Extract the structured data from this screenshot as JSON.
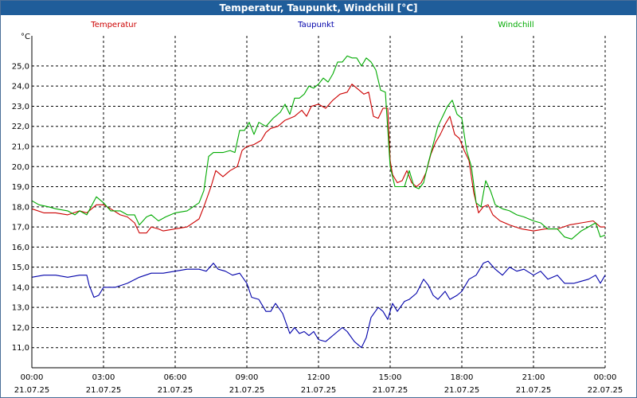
{
  "window": {
    "title": "Temperatur, Taupunkt, Windchill [°C]"
  },
  "chart_data": {
    "type": "line",
    "title": "Temperatur, Taupunkt, Windchill [°C]",
    "ylabel": "°C",
    "ylim": [
      10.0,
      26.5
    ],
    "grid": true,
    "legend_position": "top",
    "y_ticks": [
      "11,0",
      "12,0",
      "13,0",
      "14,0",
      "15,0",
      "16,0",
      "17,0",
      "18,0",
      "19,0",
      "20,0",
      "21,0",
      "22,0",
      "23,0",
      "24,0",
      "25,0"
    ],
    "x_ticks": [
      {
        "time": "00:00",
        "date": "21.07.25"
      },
      {
        "time": "03:00",
        "date": "21.07.25"
      },
      {
        "time": "06:00",
        "date": "21.07.25"
      },
      {
        "time": "09:00",
        "date": "21.07.25"
      },
      {
        "time": "12:00",
        "date": "21.07.25"
      },
      {
        "time": "15:00",
        "date": "21.07.25"
      },
      {
        "time": "18:00",
        "date": "21.07.25"
      },
      {
        "time": "21:00",
        "date": "21.07.25"
      },
      {
        "time": "00:00",
        "date": "22.07.25"
      }
    ],
    "series": [
      {
        "name": "Temperatur",
        "color": "#cc0000",
        "points": [
          [
            0,
            17.9
          ],
          [
            0.5,
            17.7
          ],
          [
            1,
            17.7
          ],
          [
            1.5,
            17.6
          ],
          [
            2,
            17.8
          ],
          [
            2.3,
            17.7
          ],
          [
            2.7,
            18.1
          ],
          [
            3,
            18.1
          ],
          [
            3.3,
            17.9
          ],
          [
            3.7,
            17.6
          ],
          [
            4,
            17.5
          ],
          [
            4.3,
            17.2
          ],
          [
            4.5,
            16.7
          ],
          [
            4.8,
            16.7
          ],
          [
            5,
            17.0
          ],
          [
            5.3,
            16.9
          ],
          [
            5.5,
            16.8
          ],
          [
            6,
            16.9
          ],
          [
            6.5,
            17.0
          ],
          [
            7,
            17.4
          ],
          [
            7.2,
            18.0
          ],
          [
            7.5,
            19.0
          ],
          [
            7.7,
            19.8
          ],
          [
            8,
            19.5
          ],
          [
            8.3,
            19.8
          ],
          [
            8.6,
            20.0
          ],
          [
            8.8,
            20.8
          ],
          [
            9,
            21.0
          ],
          [
            9.3,
            21.1
          ],
          [
            9.6,
            21.3
          ],
          [
            9.8,
            21.7
          ],
          [
            10,
            21.9
          ],
          [
            10.3,
            22.0
          ],
          [
            10.6,
            22.3
          ],
          [
            11,
            22.5
          ],
          [
            11.3,
            22.8
          ],
          [
            11.5,
            22.5
          ],
          [
            11.7,
            23.0
          ],
          [
            12,
            23.1
          ],
          [
            12.3,
            22.9
          ],
          [
            12.6,
            23.3
          ],
          [
            12.9,
            23.6
          ],
          [
            13.2,
            23.7
          ],
          [
            13.4,
            24.1
          ],
          [
            13.7,
            23.8
          ],
          [
            13.9,
            23.6
          ],
          [
            14.1,
            23.7
          ],
          [
            14.3,
            22.5
          ],
          [
            14.5,
            22.4
          ],
          [
            14.7,
            22.9
          ],
          [
            14.9,
            22.9
          ],
          [
            15.0,
            20.3
          ],
          [
            15.1,
            19.6
          ],
          [
            15.3,
            19.2
          ],
          [
            15.5,
            19.3
          ],
          [
            15.7,
            19.8
          ],
          [
            15.9,
            19.2
          ],
          [
            16.1,
            19.0
          ],
          [
            16.3,
            19.2
          ],
          [
            16.5,
            19.7
          ],
          [
            16.7,
            20.6
          ],
          [
            16.9,
            21.2
          ],
          [
            17.1,
            21.6
          ],
          [
            17.3,
            22.1
          ],
          [
            17.5,
            22.5
          ],
          [
            17.7,
            21.6
          ],
          [
            17.9,
            21.4
          ],
          [
            18.1,
            20.8
          ],
          [
            18.3,
            20.3
          ],
          [
            18.5,
            18.7
          ],
          [
            18.7,
            17.7
          ],
          [
            18.9,
            18.0
          ],
          [
            19.1,
            18.1
          ],
          [
            19.3,
            17.6
          ],
          [
            19.6,
            17.3
          ],
          [
            20,
            17.1
          ],
          [
            20.5,
            16.9
          ],
          [
            21,
            16.8
          ],
          [
            21.5,
            16.9
          ],
          [
            22,
            16.9
          ],
          [
            22.5,
            17.1
          ],
          [
            23,
            17.2
          ],
          [
            23.5,
            17.3
          ],
          [
            23.8,
            17.0
          ],
          [
            24,
            17.0
          ]
        ]
      },
      {
        "name": "Taupunkt",
        "color": "#0000aa",
        "points": [
          [
            0,
            14.5
          ],
          [
            0.5,
            14.6
          ],
          [
            1,
            14.6
          ],
          [
            1.5,
            14.5
          ],
          [
            2,
            14.6
          ],
          [
            2.3,
            14.6
          ],
          [
            2.4,
            14.1
          ],
          [
            2.6,
            13.5
          ],
          [
            2.8,
            13.6
          ],
          [
            3,
            14.0
          ],
          [
            3.5,
            14.0
          ],
          [
            4,
            14.2
          ],
          [
            4.5,
            14.5
          ],
          [
            5,
            14.7
          ],
          [
            5.5,
            14.7
          ],
          [
            6,
            14.8
          ],
          [
            6.5,
            14.9
          ],
          [
            7,
            14.9
          ],
          [
            7.3,
            14.8
          ],
          [
            7.6,
            15.2
          ],
          [
            7.8,
            14.9
          ],
          [
            8.1,
            14.8
          ],
          [
            8.4,
            14.6
          ],
          [
            8.7,
            14.7
          ],
          [
            9,
            14.2
          ],
          [
            9.2,
            13.5
          ],
          [
            9.5,
            13.4
          ],
          [
            9.8,
            12.8
          ],
          [
            10,
            12.8
          ],
          [
            10.2,
            13.2
          ],
          [
            10.5,
            12.7
          ],
          [
            10.8,
            11.7
          ],
          [
            11,
            12.0
          ],
          [
            11.2,
            11.7
          ],
          [
            11.4,
            11.8
          ],
          [
            11.6,
            11.6
          ],
          [
            11.8,
            11.8
          ],
          [
            12,
            11.4
          ],
          [
            12.3,
            11.3
          ],
          [
            12.5,
            11.5
          ],
          [
            12.7,
            11.7
          ],
          [
            13,
            12.0
          ],
          [
            13.2,
            11.8
          ],
          [
            13.5,
            11.3
          ],
          [
            13.8,
            11.0
          ],
          [
            14,
            11.5
          ],
          [
            14.2,
            12.5
          ],
          [
            14.5,
            13.0
          ],
          [
            14.7,
            12.8
          ],
          [
            14.9,
            12.4
          ],
          [
            15.1,
            13.2
          ],
          [
            15.3,
            12.8
          ],
          [
            15.6,
            13.3
          ],
          [
            15.8,
            13.4
          ],
          [
            16.1,
            13.7
          ],
          [
            16.4,
            14.4
          ],
          [
            16.6,
            14.1
          ],
          [
            16.8,
            13.6
          ],
          [
            17,
            13.4
          ],
          [
            17.3,
            13.8
          ],
          [
            17.5,
            13.4
          ],
          [
            17.8,
            13.6
          ],
          [
            18.0,
            13.8
          ],
          [
            18.3,
            14.4
          ],
          [
            18.6,
            14.6
          ],
          [
            18.9,
            15.2
          ],
          [
            19.1,
            15.3
          ],
          [
            19.4,
            14.9
          ],
          [
            19.7,
            14.6
          ],
          [
            20,
            15.0
          ],
          [
            20.3,
            14.8
          ],
          [
            20.6,
            14.9
          ],
          [
            21,
            14.6
          ],
          [
            21.3,
            14.8
          ],
          [
            21.6,
            14.4
          ],
          [
            22,
            14.6
          ],
          [
            22.3,
            14.2
          ],
          [
            22.7,
            14.2
          ],
          [
            23,
            14.3
          ],
          [
            23.3,
            14.4
          ],
          [
            23.6,
            14.6
          ],
          [
            23.8,
            14.2
          ],
          [
            24,
            14.6
          ]
        ]
      },
      {
        "name": "Windchill",
        "color": "#00aa00",
        "points": [
          [
            0,
            18.3
          ],
          [
            0.3,
            18.1
          ],
          [
            0.7,
            18.0
          ],
          [
            1,
            17.9
          ],
          [
            1.5,
            17.8
          ],
          [
            1.8,
            17.6
          ],
          [
            2,
            17.8
          ],
          [
            2.3,
            17.6
          ],
          [
            2.7,
            18.5
          ],
          [
            3,
            18.2
          ],
          [
            3.3,
            17.8
          ],
          [
            3.7,
            17.8
          ],
          [
            4,
            17.6
          ],
          [
            4.3,
            17.6
          ],
          [
            4.5,
            17.1
          ],
          [
            4.8,
            17.5
          ],
          [
            5,
            17.6
          ],
          [
            5.3,
            17.3
          ],
          [
            5.6,
            17.5
          ],
          [
            6,
            17.7
          ],
          [
            6.5,
            17.8
          ],
          [
            7,
            18.2
          ],
          [
            7.2,
            18.8
          ],
          [
            7.4,
            20.5
          ],
          [
            7.6,
            20.7
          ],
          [
            8,
            20.7
          ],
          [
            8.3,
            20.8
          ],
          [
            8.5,
            20.7
          ],
          [
            8.7,
            21.8
          ],
          [
            8.9,
            21.8
          ],
          [
            9.1,
            22.2
          ],
          [
            9.3,
            21.6
          ],
          [
            9.5,
            22.2
          ],
          [
            9.8,
            22.0
          ],
          [
            10.1,
            22.4
          ],
          [
            10.4,
            22.7
          ],
          [
            10.6,
            23.1
          ],
          [
            10.8,
            22.6
          ],
          [
            11,
            23.4
          ],
          [
            11.2,
            23.4
          ],
          [
            11.4,
            23.6
          ],
          [
            11.6,
            24.0
          ],
          [
            11.8,
            23.9
          ],
          [
            12,
            24.1
          ],
          [
            12.2,
            24.4
          ],
          [
            12.4,
            24.2
          ],
          [
            12.6,
            24.6
          ],
          [
            12.8,
            25.2
          ],
          [
            13,
            25.2
          ],
          [
            13.2,
            25.5
          ],
          [
            13.4,
            25.4
          ],
          [
            13.6,
            25.4
          ],
          [
            13.8,
            25.0
          ],
          [
            14,
            25.4
          ],
          [
            14.2,
            25.2
          ],
          [
            14.4,
            24.8
          ],
          [
            14.6,
            23.8
          ],
          [
            14.8,
            23.7
          ],
          [
            15.0,
            20.0
          ],
          [
            15.2,
            19.0
          ],
          [
            15.4,
            19.0
          ],
          [
            15.6,
            19.0
          ],
          [
            15.8,
            19.8
          ],
          [
            16.0,
            19.0
          ],
          [
            16.2,
            18.9
          ],
          [
            16.4,
            19.2
          ],
          [
            16.6,
            20.2
          ],
          [
            16.8,
            21.1
          ],
          [
            17.0,
            22.0
          ],
          [
            17.2,
            22.5
          ],
          [
            17.4,
            23.0
          ],
          [
            17.6,
            23.3
          ],
          [
            17.8,
            22.6
          ],
          [
            18.0,
            22.4
          ],
          [
            18.2,
            20.8
          ],
          [
            18.4,
            20.0
          ],
          [
            18.6,
            18.2
          ],
          [
            18.8,
            18.0
          ],
          [
            19.0,
            19.3
          ],
          [
            19.2,
            18.8
          ],
          [
            19.4,
            18.1
          ],
          [
            19.7,
            17.9
          ],
          [
            20,
            17.8
          ],
          [
            20.3,
            17.6
          ],
          [
            20.6,
            17.5
          ],
          [
            21,
            17.3
          ],
          [
            21.3,
            17.2
          ],
          [
            21.6,
            16.9
          ],
          [
            22,
            16.9
          ],
          [
            22.3,
            16.5
          ],
          [
            22.6,
            16.4
          ],
          [
            23,
            16.8
          ],
          [
            23.3,
            17.0
          ],
          [
            23.6,
            17.2
          ],
          [
            23.8,
            16.5
          ],
          [
            24,
            16.6
          ]
        ]
      }
    ]
  }
}
